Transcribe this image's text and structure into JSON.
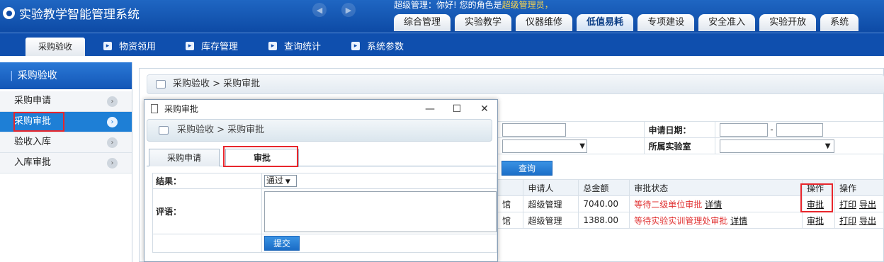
{
  "app": {
    "title": "实验教学智能管理系统"
  },
  "welcome": {
    "prefix": "超级管理：你好! 您的角色是",
    "role": "超级管理员",
    "suffix": "，"
  },
  "main_tabs": [
    "综合管理",
    "实验教学",
    "仪器维修",
    "低值易耗",
    "专项建设",
    "安全准入",
    "实验开放",
    "系统"
  ],
  "sub_nav": {
    "active": "采购验收",
    "items": [
      "物资领用",
      "库存管理",
      "查询统计",
      "系统参数"
    ]
  },
  "sidebar": {
    "title": "采购验收",
    "items": [
      "采购申请",
      "采购审批",
      "验收入库",
      "入库审批"
    ]
  },
  "page": {
    "breadcrumb": "采购验收 > 采购审批",
    "apply_date_label": "申请日期：",
    "date_sep": "-",
    "lab_label": "所属实验室",
    "query_button": "查询",
    "columns": [
      "申请人",
      "总金额",
      "审批状态",
      "操作",
      "操作"
    ],
    "rows": [
      {
        "prefix": "馆",
        "applicant": "超级管理",
        "amount": "7040.00",
        "status": "等待二级单位审批",
        "detail": "详情",
        "approve": "审批",
        "print": "打印",
        "export": "导出"
      },
      {
        "prefix": "馆",
        "applicant": "超级管理",
        "amount": "1388.00",
        "status": "等待实验实训管理处审批",
        "detail": "详情",
        "approve": "审批",
        "print": "打印",
        "export": "导出"
      }
    ]
  },
  "dialog": {
    "title": "采购审批",
    "breadcrumb": "采购验收 > 采购审批",
    "tabs": [
      "采购申请",
      "审批"
    ],
    "result_label": "结果：",
    "result_value": "通过",
    "comment_label": "评语：",
    "submit": "提交"
  },
  "colors": {
    "accent": "#0f4fae",
    "highlight": "#e8262c",
    "status": "#e03030"
  }
}
